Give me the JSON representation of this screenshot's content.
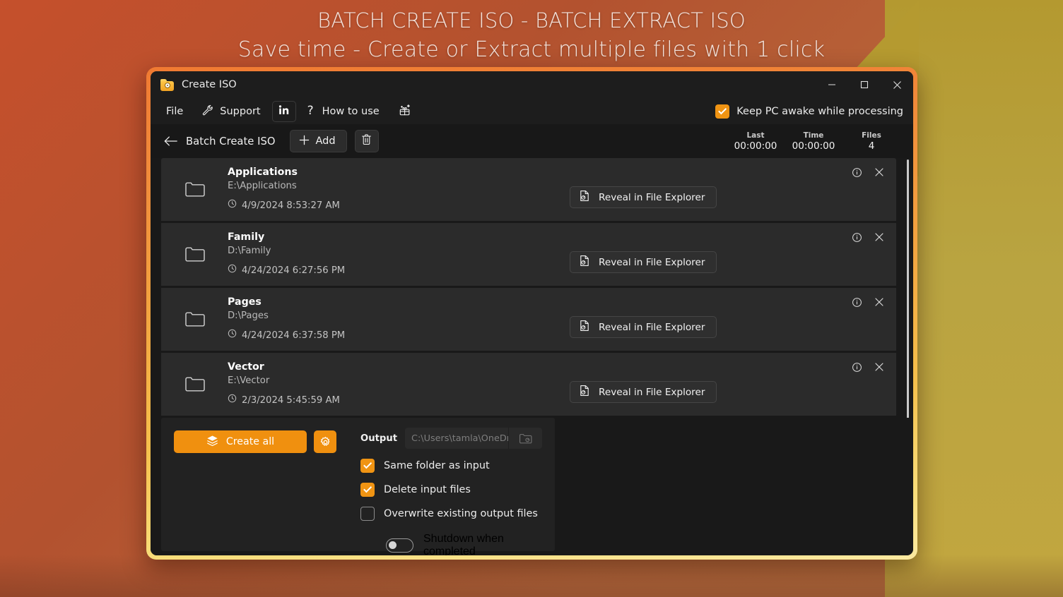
{
  "banner": {
    "line1": "BATCH CREATE ISO - BATCH EXTRACT ISO",
    "line2": "Save time - Create or Extract multiple files with 1 click"
  },
  "window": {
    "title": "Create ISO",
    "icon": "app-folder-disc-icon",
    "controls": {
      "minimize": "—",
      "maximize": "□",
      "close": "✕"
    }
  },
  "menubar": {
    "items": [
      {
        "label": "File",
        "icon": null
      },
      {
        "label": "Support",
        "icon": "wrench-icon"
      },
      {
        "label": "",
        "icon": "linkedin-icon"
      },
      {
        "label": "How to use",
        "icon": "question-mark-icon"
      },
      {
        "label": "",
        "icon": "gift-sparkle-icon"
      }
    ],
    "keep_awake": {
      "label": "Keep PC awake while processing",
      "checked": true
    }
  },
  "toolbar": {
    "back_icon": "arrow-left-icon",
    "breadcrumb": "Batch Create ISO",
    "add_label": "Add",
    "add_icon": "plus-icon",
    "delete_icon": "trash-icon",
    "stats": [
      {
        "key": "Last",
        "value": "00:00:00"
      },
      {
        "key": "Time",
        "value": "00:00:00"
      },
      {
        "key": "Files",
        "value": "4"
      }
    ]
  },
  "list": {
    "reveal_label": "Reveal in File Explorer",
    "reveal_icon": "file-reveal-icon",
    "folder_icon": "folder-icon",
    "clock_icon": "clock-icon",
    "info_icon": "info-circle-icon",
    "remove_icon": "close-x-icon",
    "rows": [
      {
        "name": "Applications",
        "path": "E:\\Applications",
        "time": "4/9/2024 8:53:27 AM"
      },
      {
        "name": "Family",
        "path": "D:\\Family",
        "time": "4/24/2024 6:27:56 PM"
      },
      {
        "name": "Pages",
        "path": "D:\\Pages",
        "time": "4/24/2024 6:37:58 PM"
      },
      {
        "name": "Vector",
        "path": "E:\\Vector",
        "time": "2/3/2024 5:45:59 AM"
      }
    ]
  },
  "bottom": {
    "create_all_label": "Create all",
    "create_all_icon": "layers-icon",
    "settings_icon": "gear-icon",
    "output_label": "Output",
    "output_value": "C:\\Users\\tamla\\OneDrive\\",
    "browse_icon": "folder-browse-icon",
    "options": [
      {
        "label": "Same folder as input",
        "checked": true
      },
      {
        "label": "Delete input files",
        "checked": true
      },
      {
        "label": "Overwrite existing output files",
        "checked": false
      }
    ],
    "shutdown": {
      "label": "Shutdown when completed",
      "on": false
    }
  },
  "colors": {
    "accent": "#f0900f",
    "window_border_top": "#f07a32",
    "window_border_bottom": "#fbe9a0",
    "bg_red": "#b6513a",
    "bg_gold": "#b59a30",
    "panel": "#222222",
    "row": "#2b2b2b",
    "app_bg": "#191919"
  }
}
